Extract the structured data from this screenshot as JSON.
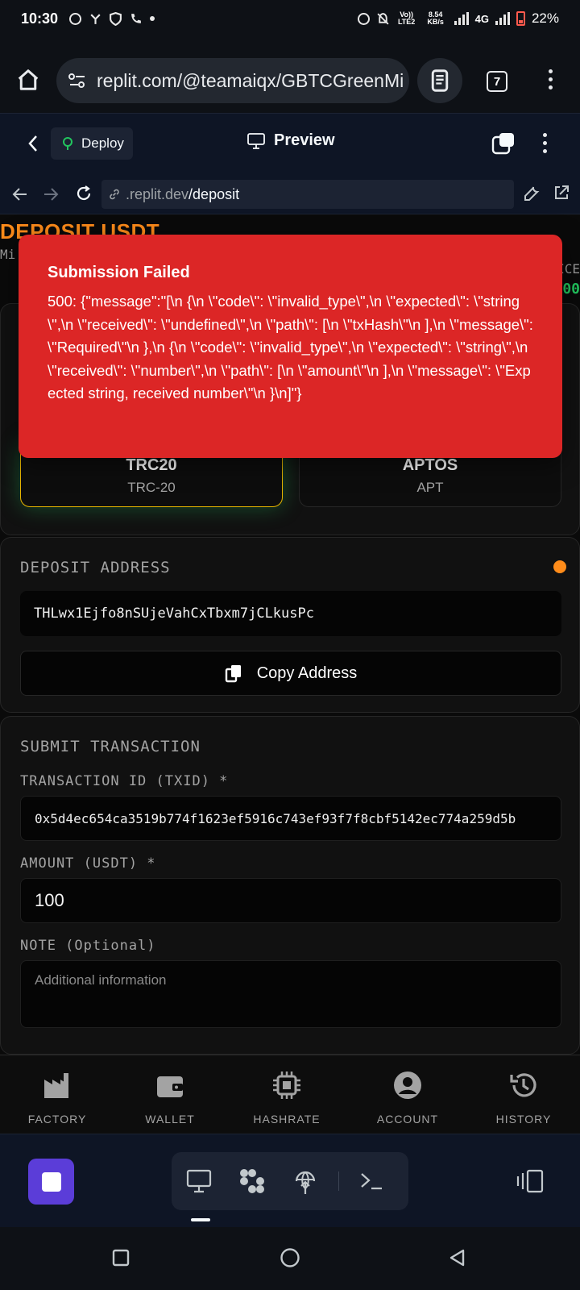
{
  "status_bar": {
    "time": "10:30",
    "volte": "Vo)) LTE2",
    "speed": "8.54 KB/s",
    "network": "4G",
    "battery": "22%"
  },
  "browser": {
    "url": "replit.com/@teamaiqx/GBTCGreenMi",
    "tab_count": "7"
  },
  "replit": {
    "deploy_label": "Deploy",
    "preview_label": "Preview"
  },
  "preview_url": {
    "host": ".replit.dev",
    "path": "/deposit"
  },
  "page": {
    "title": "DEPOSIT USDT",
    "subtitle": "Mi",
    "balance_label": "ICE",
    "balance_value": "00"
  },
  "networks": [
    {
      "name": "TRC20",
      "sub": "TRC-20",
      "active": true
    },
    {
      "name": "APTOS",
      "sub": "APT",
      "active": false
    }
  ],
  "deposit": {
    "heading": "DEPOSIT ADDRESS",
    "address": "THLwx1Ejfo8nSUjeVahCxTbxm7jCLkusPc",
    "copy_label": "Copy Address"
  },
  "transaction": {
    "heading": "SUBMIT TRANSACTION",
    "txid_label": "TRANSACTION ID (TXID) *",
    "txid_value": "0x5d4ec654ca3519b774f1623ef5916c743ef93f7f8cbf5142ec774a259d5b",
    "amount_label": "AMOUNT (USDT) *",
    "amount_value": "100",
    "note_label": "NOTE (Optional)",
    "note_placeholder": "Additional information"
  },
  "toast": {
    "title": "Submission Failed",
    "message": "500: {\"message\":\"[\\n {\\n \\\"code\\\": \\\"invalid_type\\\",\\n \\\"expected\\\": \\\"string\\\",\\n \\\"received\\\": \\\"undefined\\\",\\n \\\"path\\\": [\\n \\\"txHash\\\"\\n ],\\n \\\"message\\\": \\\"Required\\\"\\n },\\n {\\n \\\"code\\\": \\\"invalid_type\\\",\\n \\\"expected\\\": \\\"string\\\",\\n \\\"received\\\": \\\"number\\\",\\n \\\"path\\\": [\\n \\\"amount\\\"\\n ],\\n \\\"message\\\": \\\"Expected string, received number\\\"\\n }\\n]\"}"
  },
  "bottom_nav": [
    {
      "label": "FACTORY",
      "icon": "factory-icon"
    },
    {
      "label": "WALLET",
      "icon": "wallet-icon"
    },
    {
      "label": "HASHRATE",
      "icon": "chip-icon"
    },
    {
      "label": "ACCOUNT",
      "icon": "account-icon"
    },
    {
      "label": "HISTORY",
      "icon": "history-icon"
    }
  ],
  "colors": {
    "accent_orange": "#ff8c1a",
    "success_green": "#22c55e",
    "error_red": "#dc2626",
    "replit_purple": "#5b3dd8",
    "active_border": "#e6b400"
  }
}
